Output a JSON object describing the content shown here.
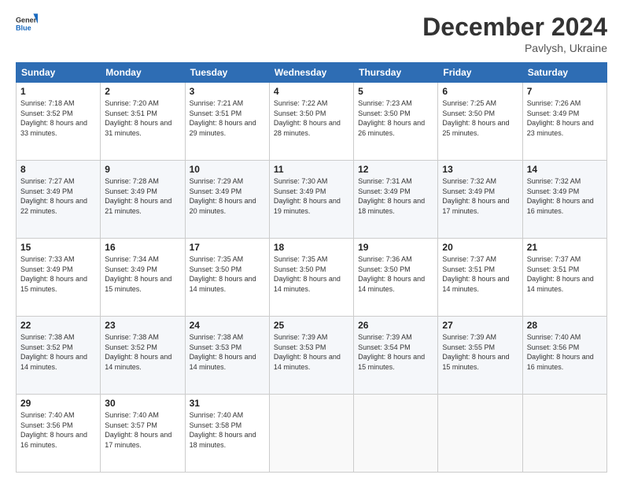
{
  "header": {
    "logo_general": "General",
    "logo_blue": "Blue",
    "month": "December 2024",
    "location": "Pavlysh, Ukraine"
  },
  "days_of_week": [
    "Sunday",
    "Monday",
    "Tuesday",
    "Wednesday",
    "Thursday",
    "Friday",
    "Saturday"
  ],
  "weeks": [
    [
      {
        "day": "1",
        "sunrise": "7:18 AM",
        "sunset": "3:52 PM",
        "daylight": "8 hours and 33 minutes."
      },
      {
        "day": "2",
        "sunrise": "7:20 AM",
        "sunset": "3:51 PM",
        "daylight": "8 hours and 31 minutes."
      },
      {
        "day": "3",
        "sunrise": "7:21 AM",
        "sunset": "3:51 PM",
        "daylight": "8 hours and 29 minutes."
      },
      {
        "day": "4",
        "sunrise": "7:22 AM",
        "sunset": "3:50 PM",
        "daylight": "8 hours and 28 minutes."
      },
      {
        "day": "5",
        "sunrise": "7:23 AM",
        "sunset": "3:50 PM",
        "daylight": "8 hours and 26 minutes."
      },
      {
        "day": "6",
        "sunrise": "7:25 AM",
        "sunset": "3:50 PM",
        "daylight": "8 hours and 25 minutes."
      },
      {
        "day": "7",
        "sunrise": "7:26 AM",
        "sunset": "3:49 PM",
        "daylight": "8 hours and 23 minutes."
      }
    ],
    [
      {
        "day": "8",
        "sunrise": "7:27 AM",
        "sunset": "3:49 PM",
        "daylight": "8 hours and 22 minutes."
      },
      {
        "day": "9",
        "sunrise": "7:28 AM",
        "sunset": "3:49 PM",
        "daylight": "8 hours and 21 minutes."
      },
      {
        "day": "10",
        "sunrise": "7:29 AM",
        "sunset": "3:49 PM",
        "daylight": "8 hours and 20 minutes."
      },
      {
        "day": "11",
        "sunrise": "7:30 AM",
        "sunset": "3:49 PM",
        "daylight": "8 hours and 19 minutes."
      },
      {
        "day": "12",
        "sunrise": "7:31 AM",
        "sunset": "3:49 PM",
        "daylight": "8 hours and 18 minutes."
      },
      {
        "day": "13",
        "sunrise": "7:32 AM",
        "sunset": "3:49 PM",
        "daylight": "8 hours and 17 minutes."
      },
      {
        "day": "14",
        "sunrise": "7:32 AM",
        "sunset": "3:49 PM",
        "daylight": "8 hours and 16 minutes."
      }
    ],
    [
      {
        "day": "15",
        "sunrise": "7:33 AM",
        "sunset": "3:49 PM",
        "daylight": "8 hours and 15 minutes."
      },
      {
        "day": "16",
        "sunrise": "7:34 AM",
        "sunset": "3:49 PM",
        "daylight": "8 hours and 15 minutes."
      },
      {
        "day": "17",
        "sunrise": "7:35 AM",
        "sunset": "3:50 PM",
        "daylight": "8 hours and 14 minutes."
      },
      {
        "day": "18",
        "sunrise": "7:35 AM",
        "sunset": "3:50 PM",
        "daylight": "8 hours and 14 minutes."
      },
      {
        "day": "19",
        "sunrise": "7:36 AM",
        "sunset": "3:50 PM",
        "daylight": "8 hours and 14 minutes."
      },
      {
        "day": "20",
        "sunrise": "7:37 AM",
        "sunset": "3:51 PM",
        "daylight": "8 hours and 14 minutes."
      },
      {
        "day": "21",
        "sunrise": "7:37 AM",
        "sunset": "3:51 PM",
        "daylight": "8 hours and 14 minutes."
      }
    ],
    [
      {
        "day": "22",
        "sunrise": "7:38 AM",
        "sunset": "3:52 PM",
        "daylight": "8 hours and 14 minutes."
      },
      {
        "day": "23",
        "sunrise": "7:38 AM",
        "sunset": "3:52 PM",
        "daylight": "8 hours and 14 minutes."
      },
      {
        "day": "24",
        "sunrise": "7:38 AM",
        "sunset": "3:53 PM",
        "daylight": "8 hours and 14 minutes."
      },
      {
        "day": "25",
        "sunrise": "7:39 AM",
        "sunset": "3:53 PM",
        "daylight": "8 hours and 14 minutes."
      },
      {
        "day": "26",
        "sunrise": "7:39 AM",
        "sunset": "3:54 PM",
        "daylight": "8 hours and 15 minutes."
      },
      {
        "day": "27",
        "sunrise": "7:39 AM",
        "sunset": "3:55 PM",
        "daylight": "8 hours and 15 minutes."
      },
      {
        "day": "28",
        "sunrise": "7:40 AM",
        "sunset": "3:56 PM",
        "daylight": "8 hours and 16 minutes."
      }
    ],
    [
      {
        "day": "29",
        "sunrise": "7:40 AM",
        "sunset": "3:56 PM",
        "daylight": "8 hours and 16 minutes."
      },
      {
        "day": "30",
        "sunrise": "7:40 AM",
        "sunset": "3:57 PM",
        "daylight": "8 hours and 17 minutes."
      },
      {
        "day": "31",
        "sunrise": "7:40 AM",
        "sunset": "3:58 PM",
        "daylight": "8 hours and 18 minutes."
      },
      null,
      null,
      null,
      null
    ]
  ],
  "labels": {
    "sunrise": "Sunrise:",
    "sunset": "Sunset:",
    "daylight": "Daylight:"
  }
}
